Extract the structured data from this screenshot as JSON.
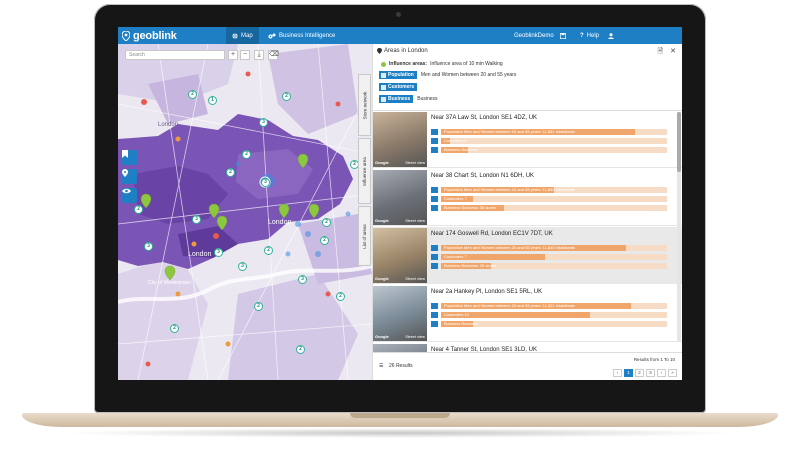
{
  "app": {
    "logo_text": "geoblink",
    "tabs": [
      {
        "label": "Map",
        "icon": "globe-icon",
        "active": true
      },
      {
        "label": "Business Intelligence",
        "icon": "gears-icon",
        "active": false
      }
    ],
    "user": "GeoblinkDemo",
    "help_label": "Help",
    "colors": {
      "brand": "#1e7fc4",
      "bar_fill": "#f0a66b",
      "bar_track": "#f6dcc5",
      "map_purple": "#7b55b6"
    }
  },
  "map": {
    "search_placeholder": "Search",
    "toolbar": [
      "zoom-in-icon",
      "zoom-out-icon",
      "download-icon",
      "eraser-icon"
    ],
    "side_tools": [
      "bookmark-icon",
      "pin-icon",
      "eye-icon"
    ],
    "vertical_tabs": [
      "Store network",
      "Influence area",
      "List of areas"
    ],
    "labels": [
      "London",
      "London",
      "City of Westminster",
      "London"
    ],
    "markers": [
      "1",
      "3",
      "2",
      "2",
      "3",
      "3",
      "2",
      "2",
      "3",
      "3",
      "2",
      "2",
      "3",
      "2",
      "2",
      "2",
      "2",
      "3",
      "2",
      "2",
      "2"
    ]
  },
  "panel": {
    "title": "Areas in London",
    "influence_label": "Influence areas:",
    "influence_value": "Influence area of 10 min Walking",
    "filters": [
      {
        "chip": "Population",
        "value": "Men and Women between 20 and 55 years"
      },
      {
        "chip": "Customers",
        "value": ""
      },
      {
        "chip": "Business",
        "value": "Business"
      }
    ],
    "results": [
      {
        "address": "Near 37A Law St, London SE1 4DZ, UK",
        "highlighted": false,
        "bars": [
          {
            "label": "Population Men and Women between 20 and 55 years: 11,681 inhabitants",
            "fraction": 0.86
          },
          {
            "label": "Customers 6",
            "fraction": 0.04
          },
          {
            "label": "Business Business",
            "fraction": 0.12
          }
        ]
      },
      {
        "address": "Near 38 Chart St, London N1 6DH, UK",
        "highlighted": false,
        "bars": [
          {
            "label": "Population Men and Women between 20 and 55 years: 11,650 inhabitants",
            "fraction": 0.5
          },
          {
            "label": "Customers 7",
            "fraction": 0.14
          },
          {
            "label": "Business Business: 38 stores",
            "fraction": 0.28
          }
        ]
      },
      {
        "address": "Near 174 Goswell Rd, London EC1V 7DT, UK",
        "highlighted": true,
        "bars": [
          {
            "label": "Population Men and Women between 20 and 55 years: 11,840 inhabitants",
            "fraction": 0.82
          },
          {
            "label": "Customers 7",
            "fraction": 0.46
          },
          {
            "label": "Business Business: 26 stores",
            "fraction": 0.22
          }
        ]
      },
      {
        "address": "Near 2a Hankey Pl, London SE1 5RL, UK",
        "highlighted": false,
        "bars": [
          {
            "label": "Population Men and Women between 20 and 55 years: 11,001 inhabitants",
            "fraction": 0.84
          },
          {
            "label": "Customers 10",
            "fraction": 0.66
          },
          {
            "label": "Business Business",
            "fraction": 0.14
          }
        ]
      },
      {
        "address": "Near 4 Tanner St, London SE1 3LD, UK",
        "highlighted": false,
        "bars": []
      }
    ],
    "thumb_google": "Google",
    "thumb_street_view": "Street view",
    "results_count": "26 Results",
    "results_range": "Results from 1 To 10",
    "pages": [
      "‹",
      "1",
      "2",
      "3",
      "›",
      "»"
    ]
  }
}
